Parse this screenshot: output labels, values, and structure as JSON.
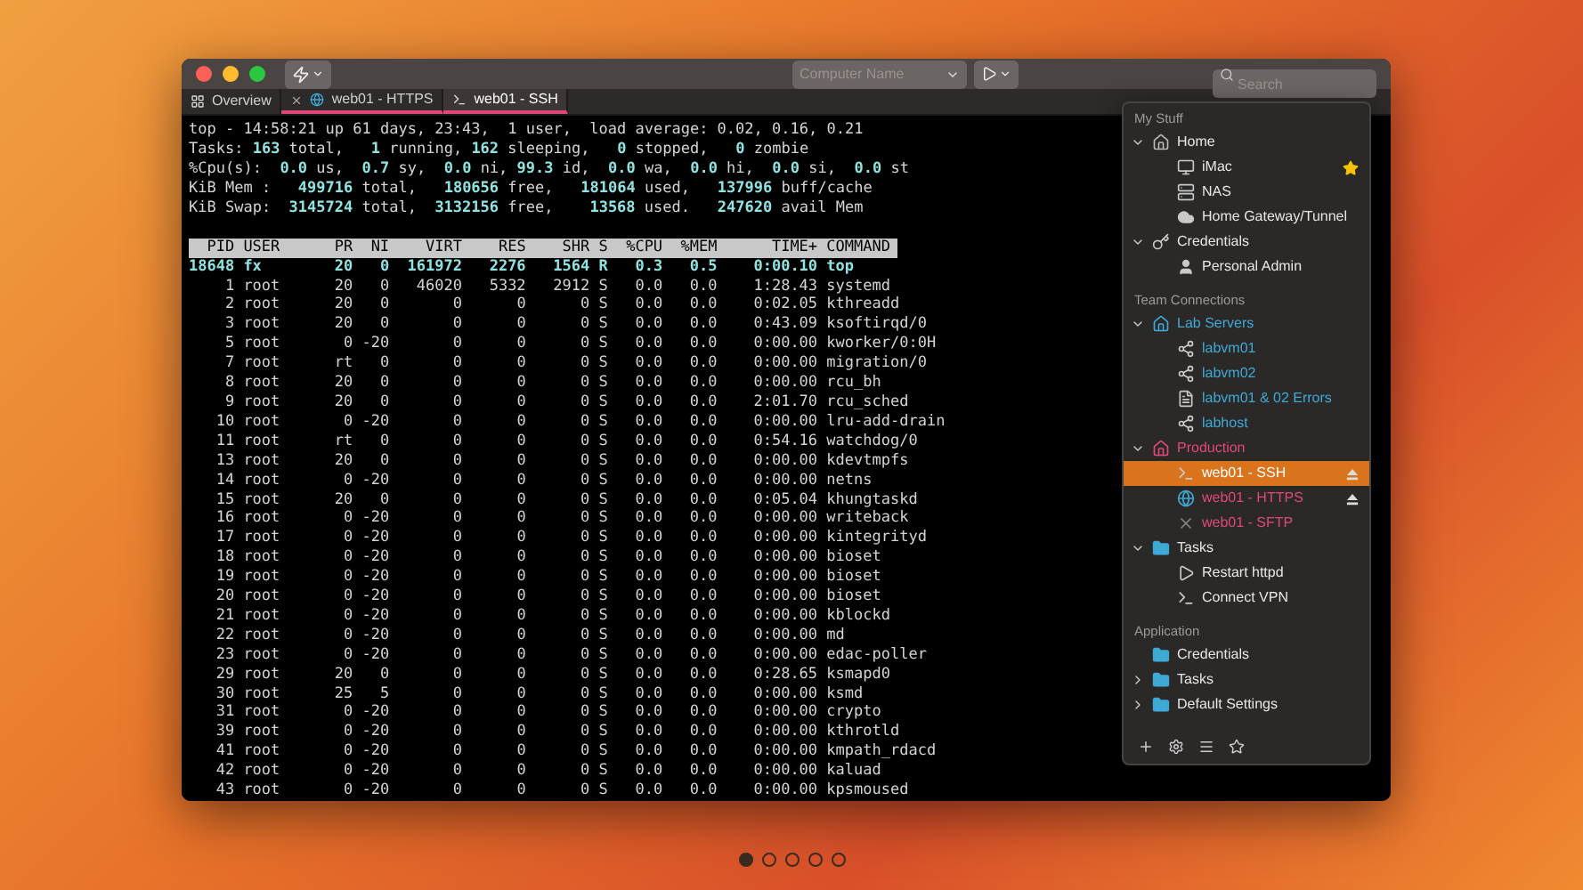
{
  "toolbar": {
    "computer_field": {
      "placeholder": "Computer Name"
    },
    "search": {
      "placeholder": "Search"
    }
  },
  "tabs": [
    {
      "kind": "overview",
      "label": "Overview",
      "selected": false
    },
    {
      "kind": "web",
      "label": "web01 - HTTPS",
      "selected": false
    },
    {
      "kind": "terminal",
      "label": "web01 - SSH",
      "selected": true
    }
  ],
  "terminal": {
    "summary": [
      "top - 14:58:21 up 61 days, 23:43,  1 user,  load average: 0.02, 0.16, 0.21",
      "Tasks: **163** total,   **1** running, **162** sleeping,   **0** stopped,   **0** zombie",
      "%Cpu(s):  **0.0** us,  **0.7** sy,  **0.0** ni, **99.3** id,  **0.0** wa,  **0.0** hi,  **0.0** si,  **0.0** st",
      "KiB Mem :   **499716** total,   **180656** free,   **181064** used,   **137996** buff/cache",
      "KiB Swap:  **3145724** total,  **3132156** free,    **13568** used.   **247620** avail Mem"
    ],
    "columns": [
      "PID",
      "USER",
      "PR",
      "NI",
      "VIRT",
      "RES",
      "SHR",
      "S",
      "%CPU",
      "%MEM",
      "TIME+",
      "COMMAND"
    ],
    "rows": [
      {
        "highlighted": true,
        "cells": [
          "18648",
          "fx",
          "20",
          "0",
          "161972",
          "2276",
          "1564",
          "R",
          "0.3",
          "0.5",
          "0:00.10",
          "top"
        ]
      },
      {
        "highlighted": false,
        "cells": [
          "1",
          "root",
          "20",
          "0",
          "46020",
          "5332",
          "2912",
          "S",
          "0.0",
          "0.0",
          "1:28.43",
          "systemd"
        ]
      },
      {
        "highlighted": false,
        "cells": [
          "2",
          "root",
          "20",
          "0",
          "0",
          "0",
          "0",
          "S",
          "0.0",
          "0.0",
          "0:02.05",
          "kthreadd"
        ]
      },
      {
        "highlighted": false,
        "cells": [
          "3",
          "root",
          "20",
          "0",
          "0",
          "0",
          "0",
          "S",
          "0.0",
          "0.0",
          "0:43.09",
          "ksoftirqd/0"
        ]
      },
      {
        "highlighted": false,
        "cells": [
          "5",
          "root",
          "0",
          "-20",
          "0",
          "0",
          "0",
          "S",
          "0.0",
          "0.0",
          "0:00.00",
          "kworker/0:0H"
        ]
      },
      {
        "highlighted": false,
        "cells": [
          "7",
          "root",
          "rt",
          "0",
          "0",
          "0",
          "0",
          "S",
          "0.0",
          "0.0",
          "0:00.00",
          "migration/0"
        ]
      },
      {
        "highlighted": false,
        "cells": [
          "8",
          "root",
          "20",
          "0",
          "0",
          "0",
          "0",
          "S",
          "0.0",
          "0.0",
          "0:00.00",
          "rcu_bh"
        ]
      },
      {
        "highlighted": false,
        "cells": [
          "9",
          "root",
          "20",
          "0",
          "0",
          "0",
          "0",
          "S",
          "0.0",
          "0.0",
          "2:01.70",
          "rcu_sched"
        ]
      },
      {
        "highlighted": false,
        "cells": [
          "10",
          "root",
          "0",
          "-20",
          "0",
          "0",
          "0",
          "S",
          "0.0",
          "0.0",
          "0:00.00",
          "lru-add-drain"
        ]
      },
      {
        "highlighted": false,
        "cells": [
          "11",
          "root",
          "rt",
          "0",
          "0",
          "0",
          "0",
          "S",
          "0.0",
          "0.0",
          "0:54.16",
          "watchdog/0"
        ]
      },
      {
        "highlighted": false,
        "cells": [
          "13",
          "root",
          "20",
          "0",
          "0",
          "0",
          "0",
          "S",
          "0.0",
          "0.0",
          "0:00.00",
          "kdevtmpfs"
        ]
      },
      {
        "highlighted": false,
        "cells": [
          "14",
          "root",
          "0",
          "-20",
          "0",
          "0",
          "0",
          "S",
          "0.0",
          "0.0",
          "0:00.00",
          "netns"
        ]
      },
      {
        "highlighted": false,
        "cells": [
          "15",
          "root",
          "20",
          "0",
          "0",
          "0",
          "0",
          "S",
          "0.0",
          "0.0",
          "0:05.04",
          "khungtaskd"
        ]
      },
      {
        "highlighted": false,
        "cells": [
          "16",
          "root",
          "0",
          "-20",
          "0",
          "0",
          "0",
          "S",
          "0.0",
          "0.0",
          "0:00.00",
          "writeback"
        ]
      },
      {
        "highlighted": false,
        "cells": [
          "17",
          "root",
          "0",
          "-20",
          "0",
          "0",
          "0",
          "S",
          "0.0",
          "0.0",
          "0:00.00",
          "kintegrityd"
        ]
      },
      {
        "highlighted": false,
        "cells": [
          "18",
          "root",
          "0",
          "-20",
          "0",
          "0",
          "0",
          "S",
          "0.0",
          "0.0",
          "0:00.00",
          "bioset"
        ]
      },
      {
        "highlighted": false,
        "cells": [
          "19",
          "root",
          "0",
          "-20",
          "0",
          "0",
          "0",
          "S",
          "0.0",
          "0.0",
          "0:00.00",
          "bioset"
        ]
      },
      {
        "highlighted": false,
        "cells": [
          "20",
          "root",
          "0",
          "-20",
          "0",
          "0",
          "0",
          "S",
          "0.0",
          "0.0",
          "0:00.00",
          "bioset"
        ]
      },
      {
        "highlighted": false,
        "cells": [
          "21",
          "root",
          "0",
          "-20",
          "0",
          "0",
          "0",
          "S",
          "0.0",
          "0.0",
          "0:00.00",
          "kblockd"
        ]
      },
      {
        "highlighted": false,
        "cells": [
          "22",
          "root",
          "0",
          "-20",
          "0",
          "0",
          "0",
          "S",
          "0.0",
          "0.0",
          "0:00.00",
          "md"
        ]
      },
      {
        "highlighted": false,
        "cells": [
          "23",
          "root",
          "0",
          "-20",
          "0",
          "0",
          "0",
          "S",
          "0.0",
          "0.0",
          "0:00.00",
          "edac-poller"
        ]
      },
      {
        "highlighted": false,
        "cells": [
          "29",
          "root",
          "20",
          "0",
          "0",
          "0",
          "0",
          "S",
          "0.0",
          "0.0",
          "0:28.65",
          "ksmapd0"
        ]
      },
      {
        "highlighted": false,
        "cells": [
          "30",
          "root",
          "25",
          "5",
          "0",
          "0",
          "0",
          "S",
          "0.0",
          "0.0",
          "0:00.00",
          "ksmd"
        ]
      },
      {
        "highlighted": false,
        "cells": [
          "31",
          "root",
          "0",
          "-20",
          "0",
          "0",
          "0",
          "S",
          "0.0",
          "0.0",
          "0:00.00",
          "crypto"
        ]
      },
      {
        "highlighted": false,
        "cells": [
          "39",
          "root",
          "0",
          "-20",
          "0",
          "0",
          "0",
          "S",
          "0.0",
          "0.0",
          "0:00.00",
          "kthrotld"
        ]
      },
      {
        "highlighted": false,
        "cells": [
          "41",
          "root",
          "0",
          "-20",
          "0",
          "0",
          "0",
          "S",
          "0.0",
          "0.0",
          "0:00.00",
          "kmpath_rdacd"
        ]
      },
      {
        "highlighted": false,
        "cells": [
          "42",
          "root",
          "0",
          "-20",
          "0",
          "0",
          "0",
          "S",
          "0.0",
          "0.0",
          "0:00.00",
          "kaluad"
        ]
      },
      {
        "highlighted": false,
        "cells": [
          "43",
          "root",
          "0",
          "-20",
          "0",
          "0",
          "0",
          "S",
          "0.0",
          "0.0",
          "0:00.00",
          "kpsmoused"
        ]
      }
    ]
  },
  "sidebar": {
    "sections": [
      {
        "title": "My Stuff",
        "items": [
          {
            "kind": "group",
            "label": "Home",
            "expanded": true,
            "children": [
              {
                "kind": "computer",
                "label": "iMac",
                "starred": true
              },
              {
                "kind": "server",
                "label": "NAS",
                "starred": false
              },
              {
                "kind": "cloud",
                "label": "Home Gateway/Tunnel",
                "starred": false
              }
            ]
          },
          {
            "kind": "key",
            "label": "Credentials",
            "expanded": true,
            "children": [
              {
                "kind": "user",
                "label": "Personal Admin",
                "starred": false
              }
            ]
          }
        ]
      },
      {
        "title": "Team Connections",
        "items": [
          {
            "kind": "group",
            "label": "Lab Servers",
            "expanded": true,
            "color": "#3fa9d6",
            "children": [
              {
                "kind": "remote",
                "label": "labvm01",
                "color": "#3fa9d6"
              },
              {
                "kind": "remote",
                "label": "labvm02",
                "color": "#3fa9d6"
              },
              {
                "kind": "document",
                "label": "labvm01 & 02 Errors",
                "color": "#3fa9d6"
              },
              {
                "kind": "remote",
                "label": "labhost",
                "color": "#3fa9d6"
              }
            ]
          },
          {
            "kind": "group",
            "label": "Production",
            "expanded": true,
            "color": "#e0487a",
            "children": [
              {
                "kind": "terminal",
                "label": "web01 - SSH",
                "selected": true,
                "connected": true
              },
              {
                "kind": "web",
                "label": "web01 - HTTPS",
                "color": "#e0487a",
                "selected": false,
                "connected": true
              },
              {
                "kind": "sftp",
                "label": "web01 - SFTP",
                "color": "#e0487a",
                "selected": false,
                "connected": false
              }
            ]
          },
          {
            "kind": "folder",
            "label": "Tasks",
            "expanded": true,
            "children": [
              {
                "kind": "task",
                "label": "Restart httpd"
              },
              {
                "kind": "terminal",
                "label": "Connect VPN"
              }
            ]
          }
        ]
      },
      {
        "title": "Application",
        "items": [
          {
            "kind": "folder",
            "label": "Credentials"
          },
          {
            "kind": "folder",
            "label": "Tasks",
            "expanded": false
          },
          {
            "kind": "folder",
            "label": "Default Settings",
            "expanded": false
          }
        ]
      }
    ]
  },
  "pages": [
    {
      "selected": true
    },
    {
      "selected": false
    },
    {
      "selected": false
    },
    {
      "selected": false
    },
    {
      "selected": false
    }
  ]
}
